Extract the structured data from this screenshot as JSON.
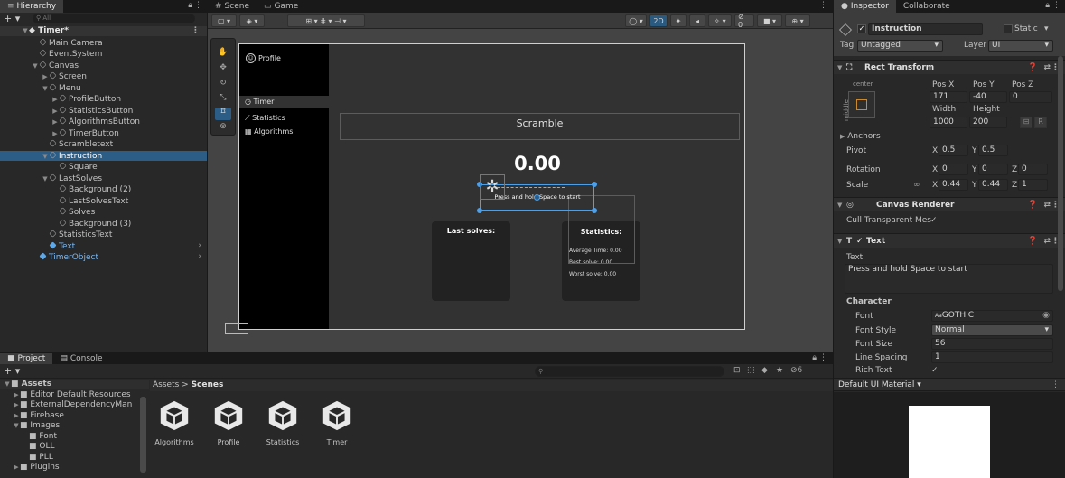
{
  "hierarchy": {
    "tab_label": "Hierarchy",
    "search_placeholder": "All",
    "items": [
      {
        "label": "Timer*",
        "depth": 0,
        "arrow": "down",
        "type": "scene"
      },
      {
        "label": "Main Camera",
        "depth": 1,
        "arrow": "",
        "type": "go"
      },
      {
        "label": "EventSystem",
        "depth": 1,
        "arrow": "",
        "type": "go"
      },
      {
        "label": "Canvas",
        "depth": 1,
        "arrow": "down",
        "type": "go"
      },
      {
        "label": "Screen",
        "depth": 2,
        "arrow": "right",
        "type": "go"
      },
      {
        "label": "Menu",
        "depth": 2,
        "arrow": "down",
        "type": "go"
      },
      {
        "label": "ProfileButton",
        "depth": 3,
        "arrow": "right",
        "type": "go"
      },
      {
        "label": "StatisticsButton",
        "depth": 3,
        "arrow": "right",
        "type": "go"
      },
      {
        "label": "AlgorithmsButton",
        "depth": 3,
        "arrow": "right",
        "type": "go"
      },
      {
        "label": "TimerButton",
        "depth": 3,
        "arrow": "right",
        "type": "go"
      },
      {
        "label": "Scrambletext",
        "depth": 2,
        "arrow": "",
        "type": "go"
      },
      {
        "label": "Instruction",
        "depth": 2,
        "arrow": "down",
        "type": "go",
        "selected": true
      },
      {
        "label": "Square",
        "depth": 3,
        "arrow": "",
        "type": "go"
      },
      {
        "label": "LastSolves",
        "depth": 2,
        "arrow": "down",
        "type": "go"
      },
      {
        "label": "Background (2)",
        "depth": 3,
        "arrow": "",
        "type": "go"
      },
      {
        "label": "LastSolvesText",
        "depth": 3,
        "arrow": "",
        "type": "go"
      },
      {
        "label": "Solves",
        "depth": 3,
        "arrow": "",
        "type": "go"
      },
      {
        "label": "Background (3)",
        "depth": 3,
        "arrow": "",
        "type": "go"
      },
      {
        "label": "StatisticsText",
        "depth": 2,
        "arrow": "",
        "type": "go"
      },
      {
        "label": "Text",
        "depth": 2,
        "arrow": "",
        "type": "prefab",
        "chevron": true
      },
      {
        "label": "TimerObject",
        "depth": 1,
        "arrow": "",
        "type": "prefab",
        "chevron": true
      }
    ]
  },
  "center_tabs": {
    "scene": "Scene",
    "game": "Game"
  },
  "toolbar": {
    "mode_2d": "2D"
  },
  "game_view": {
    "menu": {
      "profile": "Profile",
      "timer": "Timer",
      "statistics": "Statistics",
      "algorithms": "Algorithms"
    },
    "scramble": "Scramble",
    "timer_value": "0.00",
    "instruction": "Press and hold Space to start",
    "last_solves_title": "Last solves:",
    "statistics_title": "Statistics:",
    "stats": [
      "Average Time: 0.00",
      "Best solve: 0.00",
      "Worst solve: 0.00"
    ]
  },
  "project": {
    "tab_project": "Project",
    "tab_console": "Console",
    "hidden_count": "6",
    "tree": [
      {
        "label": "Assets",
        "depth": 0,
        "arrow": "down",
        "bold": true
      },
      {
        "label": "Editor Default Resources",
        "depth": 1,
        "arrow": "right"
      },
      {
        "label": "ExternalDependencyMan",
        "depth": 1,
        "arrow": "right"
      },
      {
        "label": "Firebase",
        "depth": 1,
        "arrow": "right"
      },
      {
        "label": "Images",
        "depth": 1,
        "arrow": "down"
      },
      {
        "label": "Font",
        "depth": 2,
        "arrow": ""
      },
      {
        "label": "OLL",
        "depth": 2,
        "arrow": ""
      },
      {
        "label": "PLL",
        "depth": 2,
        "arrow": ""
      },
      {
        "label": "Plugins",
        "depth": 1,
        "arrow": "right"
      }
    ],
    "breadcrumb_root": "Assets",
    "breadcrumb_current": "Scenes",
    "assets": [
      "Algorithms",
      "Profile",
      "Statistics",
      "Timer"
    ]
  },
  "inspector": {
    "tab_inspector": "Inspector",
    "tab_collaborate": "Collaborate",
    "object_name": "Instruction",
    "static_label": "Static",
    "tag_label": "Tag",
    "tag_value": "Untagged",
    "layer_label": "Layer",
    "layer_value": "UI",
    "rect_transform": {
      "title": "Rect Transform",
      "anchor_h": "center",
      "anchor_v": "middle",
      "posx_label": "Pos X",
      "posy_label": "Pos Y",
      "posz_label": "Pos Z",
      "posx": "171",
      "posy": "-40",
      "posz": "0",
      "width_label": "Width",
      "height_label": "Height",
      "width": "1000",
      "height": "200",
      "r_btn": "R",
      "anchors_label": "Anchors",
      "pivot_label": "Pivot",
      "pivot_x": "0.5",
      "pivot_y": "0.5",
      "rotation_label": "Rotation",
      "rot_x": "0",
      "rot_y": "0",
      "rot_z": "0",
      "scale_label": "Scale",
      "scale_x": "0.44",
      "scale_y": "0.44",
      "scale_z": "1",
      "x_letter": "X",
      "y_letter": "Y",
      "z_letter": "Z"
    },
    "canvas_renderer": {
      "title": "Canvas Renderer",
      "cull_label": "Cull Transparent Mes"
    },
    "text_component": {
      "title": "Text",
      "text_label": "Text",
      "text_value": "Press and hold Space to start",
      "character_label": "Character",
      "font_label": "Font",
      "font_value": "GOTHIC",
      "font_prefix": "Aa",
      "style_label": "Font Style",
      "style_value": "Normal",
      "size_label": "Font Size",
      "size_value": "56",
      "spacing_label": "Line Spacing",
      "spacing_value": "1",
      "rich_label": "Rich Text"
    },
    "material_label": "Default UI Material"
  },
  "colors": {
    "accent": "#2c5d87",
    "gizmo_blue": "#4d9fe8",
    "prefab_blue": "#5fa8e8"
  }
}
